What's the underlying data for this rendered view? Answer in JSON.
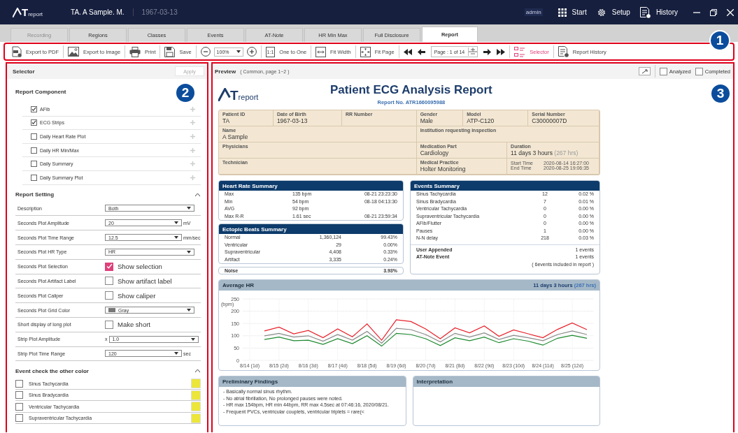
{
  "app": {
    "logo_mark": "T",
    "logo_text": "report",
    "patient": "TA. A Sample. M.",
    "birth_date": "1967-03-13",
    "user": "admin",
    "nav": [
      {
        "label": "Start"
      },
      {
        "label": "Setup"
      },
      {
        "label": "History"
      }
    ]
  },
  "tabs": [
    {
      "label": "Recording",
      "selected": false,
      "disabled": true
    },
    {
      "label": "Regions",
      "selected": false,
      "disabled": false
    },
    {
      "label": "Classes",
      "selected": false,
      "disabled": false
    },
    {
      "label": "Events",
      "selected": false,
      "disabled": false
    },
    {
      "label": "AT-Note",
      "selected": false,
      "disabled": false
    },
    {
      "label": "HR Min Max",
      "selected": false,
      "disabled": false
    },
    {
      "label": "Full Disclosure",
      "selected": false,
      "disabled": false
    },
    {
      "label": "Report",
      "selected": true,
      "disabled": false
    }
  ],
  "toolbar": [
    {
      "kind": "button",
      "label": "Export to PDF",
      "active": false
    },
    {
      "kind": "button",
      "label": "Export to Image",
      "active": false
    },
    {
      "kind": "button",
      "label": "Print",
      "active": false
    },
    {
      "kind": "button",
      "label": "Save",
      "active": false
    },
    {
      "kind": "zoom",
      "value": "100%"
    },
    {
      "kind": "button",
      "glyph": "1:1",
      "label": "One to One",
      "active": false
    },
    {
      "kind": "button",
      "label": "Fit Width",
      "active": false
    },
    {
      "kind": "button",
      "label": "Fit Page",
      "active": false
    },
    {
      "kind": "pager",
      "value": "Page : 1 of 14"
    },
    {
      "kind": "button",
      "label": "Selector",
      "active": true
    },
    {
      "kind": "button",
      "label": "Report History",
      "active": false
    }
  ],
  "callouts": [
    "1",
    "2",
    "3"
  ],
  "selector": {
    "title": "Selector",
    "apply": "Apply",
    "apply_disabled": true,
    "component_title": "Report Component",
    "components": [
      {
        "label": "AFib",
        "checked": true
      },
      {
        "label": "ECG Strips",
        "checked": true
      },
      {
        "label": "Daily Heart Rate Plot",
        "checked": false
      },
      {
        "label": "Daily HR Min/Max",
        "checked": false
      },
      {
        "label": "Daily Summary",
        "checked": false
      },
      {
        "label": "Daily Summary Plot",
        "checked": false
      }
    ],
    "setting_title": "Report Setting",
    "settings": [
      {
        "kind": "select",
        "label": "Description",
        "value": "Both"
      },
      {
        "kind": "select",
        "label": "Seconds Plot Amplitude",
        "value": "20",
        "unit": "mV"
      },
      {
        "kind": "select",
        "label": "Seconds Plot Time Range",
        "value": "12.5",
        "unit": "mm/sec"
      },
      {
        "kind": "select",
        "label": "Seconds Plot HR Type",
        "value": "HR"
      },
      {
        "kind": "check",
        "label": "Seconds Plot Selection",
        "text": "Show selection",
        "checked": true
      },
      {
        "kind": "check",
        "label": "Seconds Plot Artifact Label",
        "text": "Show artifact label",
        "checked": false
      },
      {
        "kind": "check",
        "label": "Seconds Plot Caliper",
        "text": "Show caliper",
        "checked": false
      },
      {
        "kind": "color",
        "label": "Seconds Plot Grid Color",
        "value": "Gray"
      },
      {
        "kind": "check",
        "label": "Short display of long plot",
        "text": "Make short",
        "checked": false
      },
      {
        "kind": "select",
        "label": "Strip Plot Amplitude",
        "prefix": "x",
        "value": "1.0"
      },
      {
        "kind": "select",
        "label": "Strip Plot Time Range",
        "value": "120",
        "unit": "sec"
      }
    ],
    "event_title": "Event check the other color",
    "events": [
      {
        "label": "Sinus Tachycardia",
        "checked": false,
        "color": "#ece63a"
      },
      {
        "label": "Sinus Bradycardia",
        "checked": false,
        "color": "#ece63a"
      },
      {
        "label": "Ventricular Tachycardia",
        "checked": false,
        "color": "#ece63a"
      },
      {
        "label": "Supraventricular Tachycardia",
        "checked": false,
        "color": "#ece63a"
      }
    ]
  },
  "preview": {
    "title": "Preview",
    "subtitle": "( Common, page 1~2 )",
    "analyzed_label": "Analyzed",
    "analyzed": false,
    "completed_label": "Completed",
    "completed": false
  },
  "report": {
    "logo_mark": "T",
    "logo_text": "report",
    "title": "Patient ECG Analysis Report",
    "report_no": "Report No. ATR1660095988",
    "info": [
      {
        "label": "Patient ID",
        "value": "TA"
      },
      {
        "label": "Date of Birth",
        "value": "1967-03-13"
      },
      {
        "label": "RR Number"
      },
      {
        "label": "Gender",
        "value": "Male"
      },
      {
        "label": "Model",
        "value": "ATP-C120"
      },
      {
        "label": "Serial Number",
        "value": "C30000007D"
      },
      {
        "label": "Name",
        "value": "A Sample"
      },
      {
        "label": "Institution requesting inspection"
      },
      {
        "label": "Physicians"
      },
      {
        "label": "Medication Part",
        "value": "Cardiology"
      },
      {
        "label": "Duration",
        "value": "11 days 3 hours",
        "note": "(267 hrs)"
      },
      {
        "label": "Technician"
      },
      {
        "label": "Medical Practice",
        "value": "Holter Monitoring"
      },
      {
        "times": [
          {
            "label": "Start Time",
            "value": "2020-08-14 16:27:00"
          },
          {
            "label": "End Time",
            "value": "2020-08-25 19:06:35"
          }
        ]
      }
    ],
    "hr_summary": {
      "title": "Heart Rate Summary",
      "rows": [
        [
          "Max",
          "135 bpm",
          "08-21 23:23:30"
        ],
        [
          "Min",
          "54 bpm",
          "08-18 04:13:30"
        ],
        [
          "AVG",
          "92 bpm"
        ],
        [
          "Max R-R",
          "1.61 sec",
          "08-21 23:59:34"
        ]
      ]
    },
    "ectopic": {
      "title": "Ectopic Beats Summary",
      "rows": [
        [
          "Normal",
          "1,360,124",
          "99.43%"
        ],
        [
          "Ventricular",
          "29",
          "0.00%"
        ],
        [
          "Supraventricular",
          "4,408",
          "0.33%"
        ],
        [
          "Artifact",
          "3,335",
          "0.24%"
        ]
      ]
    },
    "noise": {
      "label": "Noise",
      "value": "3.93%"
    },
    "events": {
      "title": "Events Summary",
      "rows": [
        [
          "Sinus Tachycardia",
          "12",
          "0.02 %"
        ],
        [
          "Sinus Bradycardia",
          "7",
          "0.01 %"
        ],
        [
          "Ventricular Tachycardia",
          "0",
          "0.00 %"
        ],
        [
          "Supraventricular Tachycardia",
          "0",
          "0.00 %"
        ],
        [
          "AFib/Flutter",
          "0",
          "0.00 %"
        ],
        [
          "Pauses",
          "1",
          "0.00 %"
        ],
        [
          "N-N delay",
          "218",
          "0.03 %"
        ]
      ],
      "extra": [
        [
          "User Appended",
          "1 events"
        ],
        [
          "AT-Note Event",
          "1 events"
        ]
      ],
      "footnote": "( 6events included in report )"
    },
    "avg_hr": {
      "duration": "11 days 3 hours",
      "duration_note": "(267 hrs)",
      "chart_data": {
        "type": "line",
        "title": "Average HR",
        "ylabel": "(bpm)",
        "categories": [
          "8/14 (1d)",
          null,
          "8/15 (2d)",
          null,
          "8/16 (3d)",
          null,
          "8/17 (4d)",
          null,
          "8/18 (5d)",
          null,
          "8/19 (6d)",
          null,
          "8/20 (7d)",
          null,
          "8/21 (8d)",
          null,
          "8/22 (9d)",
          null,
          "8/23 (10d)",
          null,
          "8/24 (11d)",
          null,
          "8/25 (12d)",
          null
        ],
        "series": [
          {
            "color": "#e8202a",
            "values": [
              null,
              120,
              135,
              108,
              122,
              92,
              128,
              96,
              148,
              82,
              165,
              158,
              128,
              88,
              132,
              112,
              140,
              98,
              124,
              108,
              92,
              126,
              152,
              125
            ]
          },
          {
            "color": "#8a8a8a",
            "values": [
              null,
              100,
              110,
              95,
              100,
              78,
              105,
              82,
              118,
              70,
              130,
              125,
              105,
              75,
              110,
              95,
              112,
              85,
              102,
              92,
              80,
              105,
              120,
              105
            ]
          },
          {
            "color": "#1e8a30",
            "values": [
              null,
              85,
              95,
              80,
              82,
              65,
              88,
              68,
              100,
              58,
              110,
              105,
              88,
              60,
              92,
              80,
              95,
              72,
              88,
              78,
              62,
              90,
              102,
              90
            ]
          }
        ],
        "ylim": [
          0,
          250
        ],
        "grid": true,
        "yticks": [
          0,
          50,
          100,
          150,
          200,
          250
        ]
      }
    },
    "findings": {
      "title": "Preliminary Findings",
      "lines": [
        "- Basically normal sinus rhythm.",
        "- No atrial fibrillation, No prolonged pauses were noted.",
        "- HR max 154bpm, HR min 44bpm, RR max 4.5sec at 07:46:16, 2020/08/21.",
        "- Frequent PVCs, ventricular couplets, ventricular triplets = rare(<"
      ]
    },
    "interpretation": {
      "title": "Interpretation"
    }
  }
}
